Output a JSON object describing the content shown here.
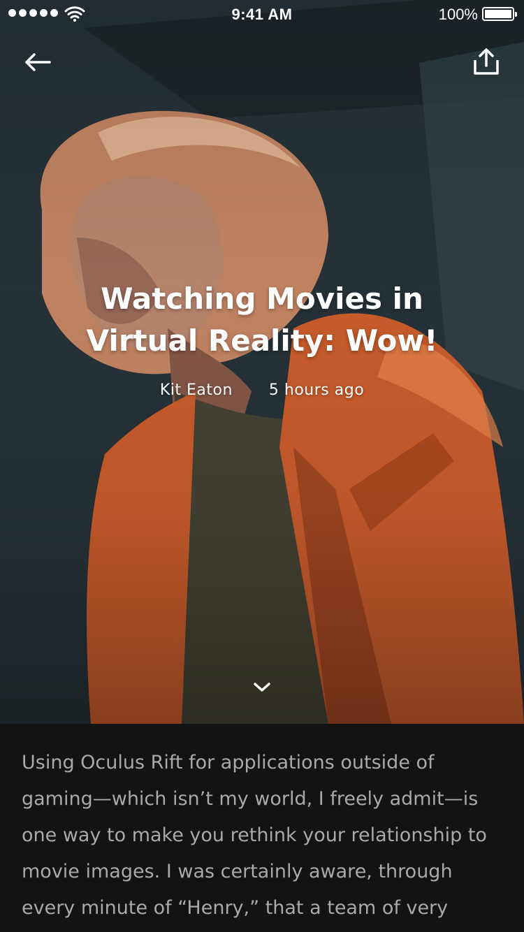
{
  "status_bar": {
    "time": "9:41 AM",
    "battery_percent": "100%",
    "signal_bars": 5,
    "icons": [
      "signal-dots-icon",
      "wifi-icon",
      "battery-icon"
    ]
  },
  "nav": {
    "back_icon": "arrow-left-icon",
    "share_icon": "share-icon"
  },
  "article": {
    "title": "Watching Movies in Virtual Reality: Wow!",
    "author": "Kit Eaton",
    "time_ago": "5 hours ago",
    "scroll_icon": "chevron-down-icon",
    "body": "Using Oculus Rift for applications outside of gaming—which isn’t my world, I freely admit—is one way to make you rethink your relationship to movie images. I was certainly aware, through every minute of “Henry,” that a team of very"
  },
  "colors": {
    "background": "#131313",
    "body_text": "#a9a9a9",
    "accent_coat": "#d2602e"
  }
}
